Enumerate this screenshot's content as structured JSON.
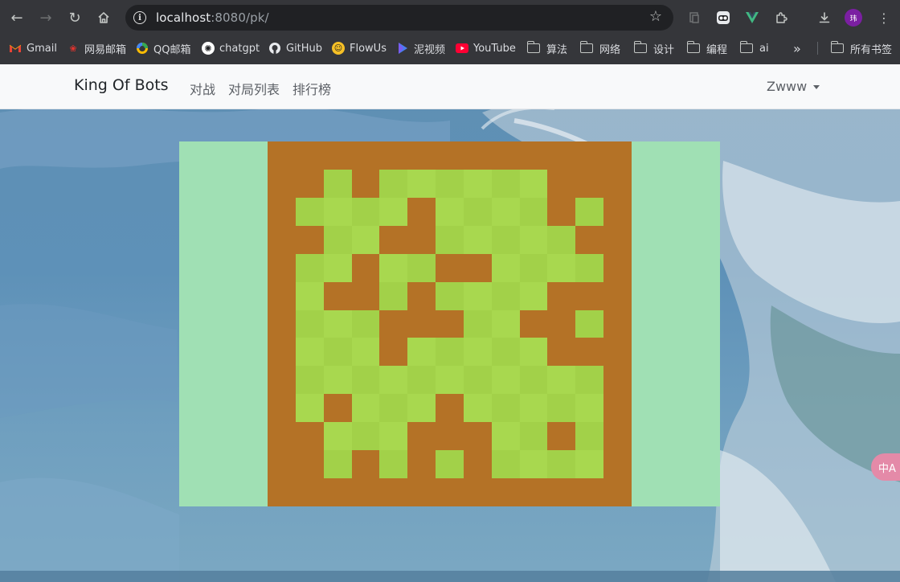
{
  "browser": {
    "url_host": "localhost",
    "url_rest": ":8080/pk/",
    "profile_initial": "玮",
    "bookmarks": [
      {
        "label": "Gmail",
        "icon": "gmail-icon"
      },
      {
        "label": "网易邮箱",
        "icon": "netease-mail-icon"
      },
      {
        "label": "QQ邮箱",
        "icon": "qq-mail-icon"
      },
      {
        "label": "chatgpt",
        "icon": "chatgpt-icon"
      },
      {
        "label": "GitHub",
        "icon": "github-icon"
      },
      {
        "label": "FlowUs",
        "icon": "flowus-icon"
      },
      {
        "label": "泥视频",
        "icon": "video-icon"
      },
      {
        "label": "YouTube",
        "icon": "youtube-icon"
      },
      {
        "label": "算法",
        "icon": "folder-icon"
      },
      {
        "label": "网络",
        "icon": "folder-icon"
      },
      {
        "label": "设计",
        "icon": "folder-icon"
      },
      {
        "label": "编程",
        "icon": "folder-icon"
      },
      {
        "label": "ai",
        "icon": "folder-icon"
      }
    ],
    "all_bookmarks": "所有书签",
    "more_glyph": "»"
  },
  "navbar": {
    "brand": "King Of Bots",
    "links": [
      "对战",
      "对局列表",
      "排行榜"
    ],
    "user": "Zwww"
  },
  "colors": {
    "wall": "#b47226",
    "grass_a": "#a8d84f",
    "grass_b": "#a2d149",
    "playground": "#a0e0b4"
  },
  "game_map": {
    "rows": 13,
    "cols": 13,
    "grid": [
      "1111111111111",
      "1101000000111",
      "1000010000101",
      "1100110000011",
      "1001001100001",
      "1011010000111",
      "1000111001101",
      "1000100000111",
      "1000000000001",
      "1010001000001",
      "1100011100101",
      "1101010100001",
      "1111111111111"
    ]
  },
  "translate_badge": "中A"
}
